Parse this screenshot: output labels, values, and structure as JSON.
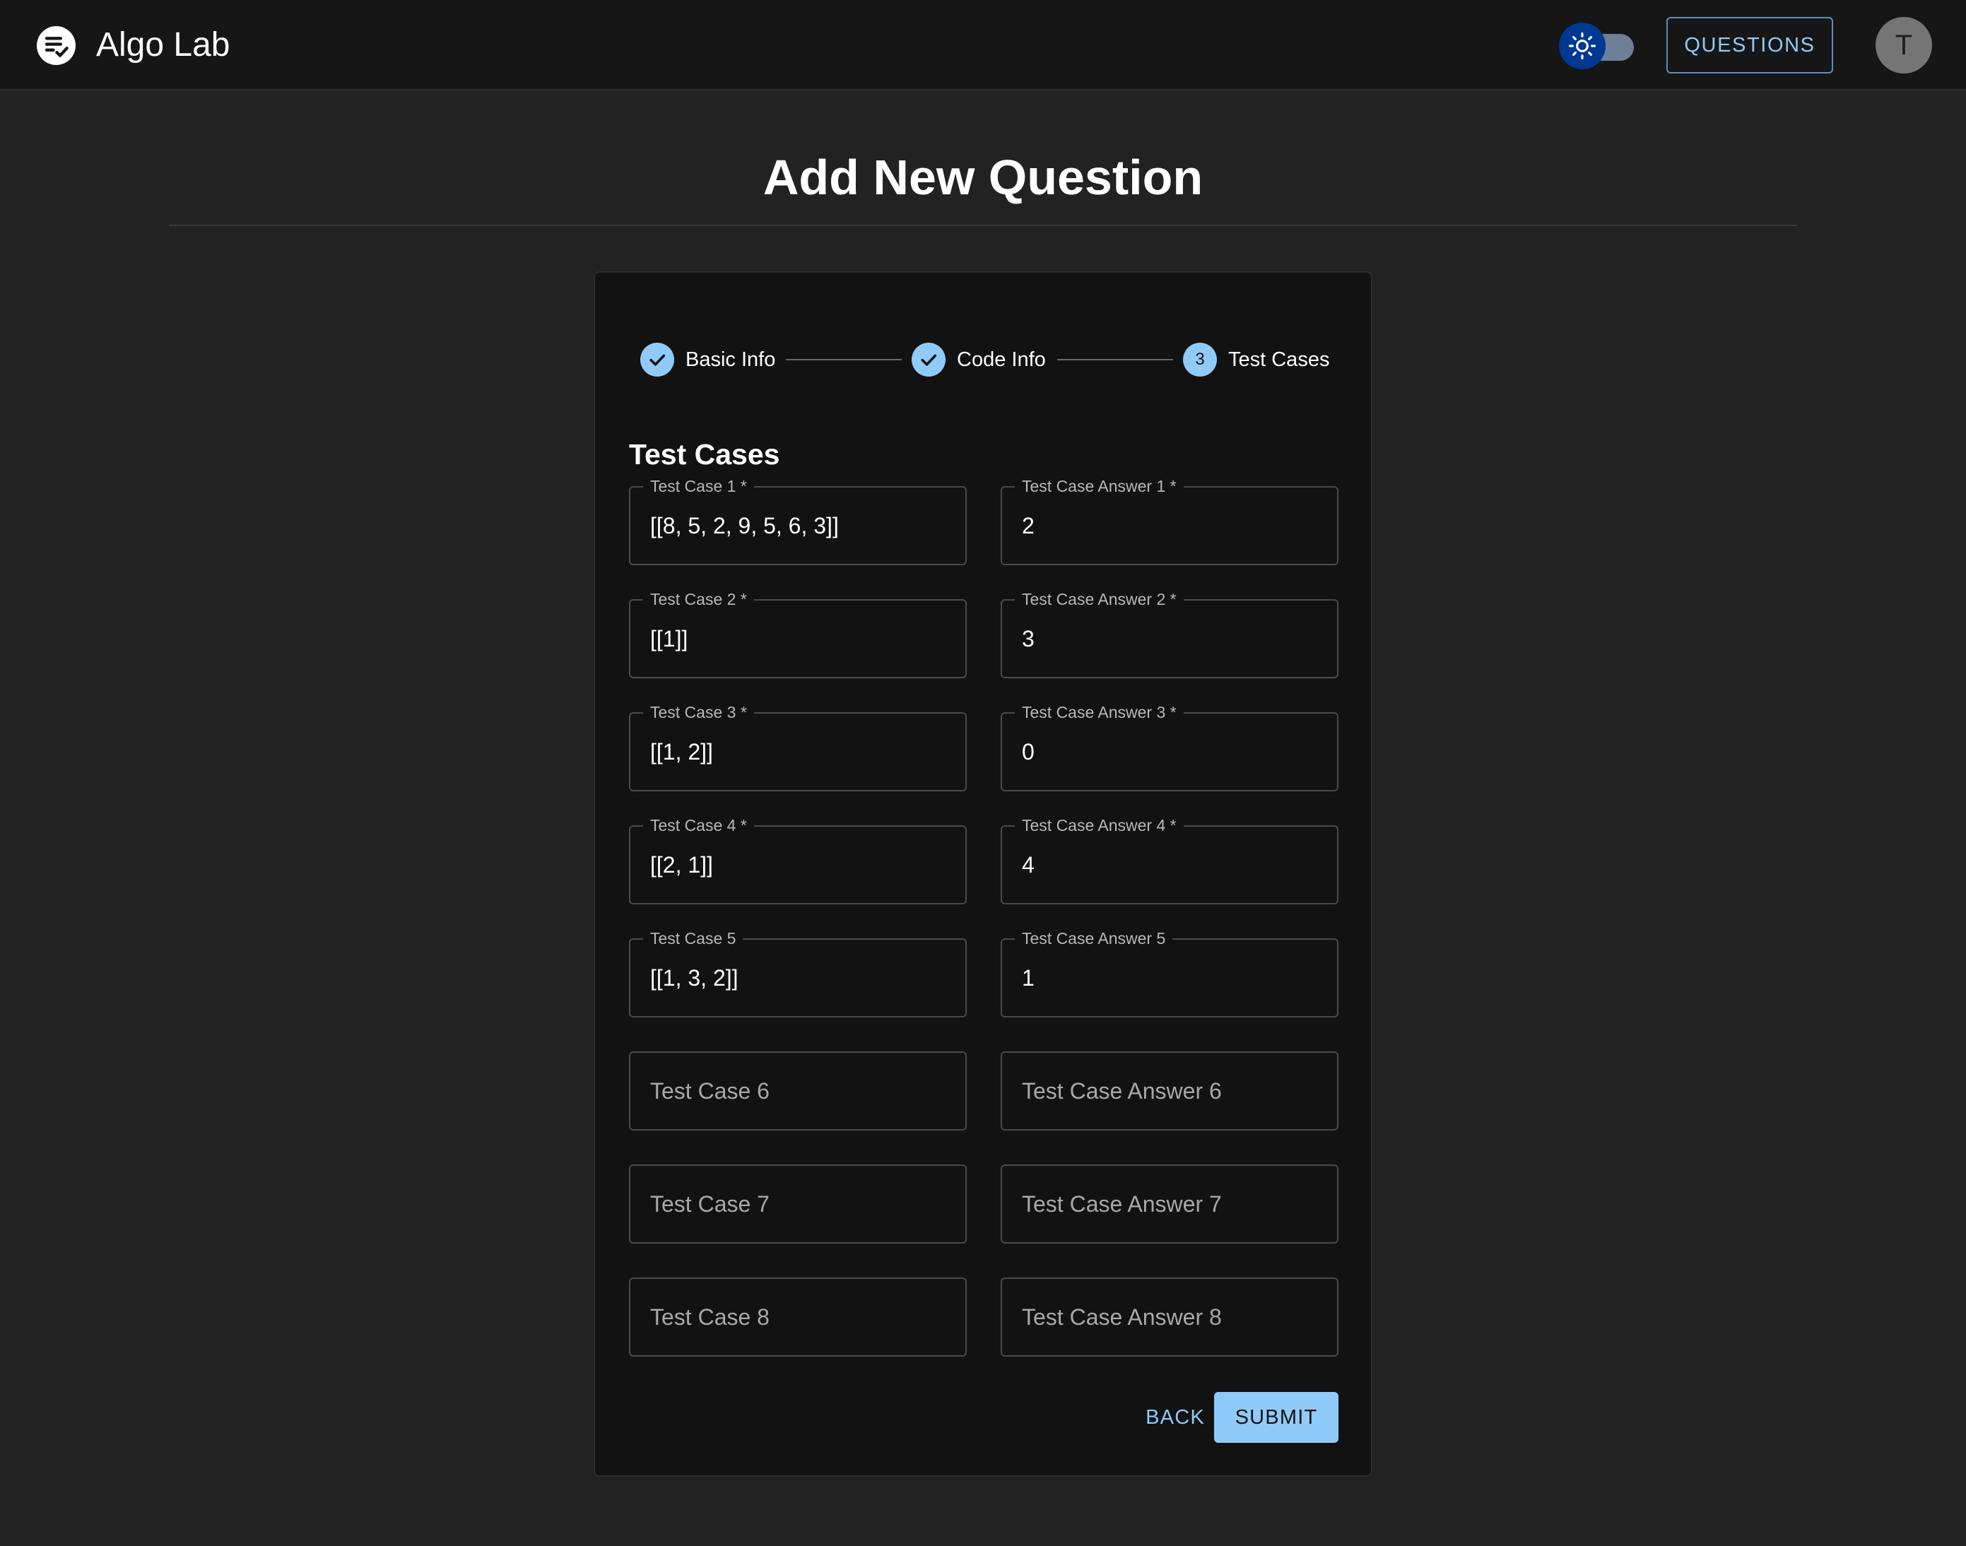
{
  "app": {
    "title": "Algo Lab",
    "logo_icon": "quiz-check-icon"
  },
  "header": {
    "theme_toggle_icon": "sun-icon",
    "theme_mode": "dark",
    "questions_label": "QUESTIONS",
    "avatar_initial": "T"
  },
  "page": {
    "title": "Add New Question"
  },
  "stepper": {
    "steps": [
      {
        "label": "Basic Info",
        "state": "completed",
        "icon": "check-icon"
      },
      {
        "label": "Code Info",
        "state": "completed",
        "icon": "check-icon"
      },
      {
        "label": "Test Cases",
        "state": "active",
        "number": "3"
      }
    ]
  },
  "form": {
    "section_title": "Test Cases",
    "rows": [
      {
        "case": {
          "label": "Test Case 1 *",
          "value": "[[8, 5, 2, 9, 5, 6, 3]]",
          "placeholder": ""
        },
        "answer": {
          "label": "Test Case Answer 1 *",
          "value": "2",
          "placeholder": ""
        }
      },
      {
        "case": {
          "label": "Test Case 2 *",
          "value": "[[1]]",
          "placeholder": ""
        },
        "answer": {
          "label": "Test Case Answer 2 *",
          "value": "3",
          "placeholder": ""
        }
      },
      {
        "case": {
          "label": "Test Case 3 *",
          "value": "[[1, 2]]",
          "placeholder": ""
        },
        "answer": {
          "label": "Test Case Answer 3 *",
          "value": "0",
          "placeholder": ""
        }
      },
      {
        "case": {
          "label": "Test Case 4 *",
          "value": "[[2, 1]]",
          "placeholder": ""
        },
        "answer": {
          "label": "Test Case Answer 4 *",
          "value": "4",
          "placeholder": ""
        }
      },
      {
        "case": {
          "label": "Test Case 5",
          "value": "[[1, 3, 2]]",
          "placeholder": ""
        },
        "answer": {
          "label": "Test Case Answer 5",
          "value": "1",
          "placeholder": ""
        }
      },
      {
        "case": {
          "label": "",
          "value": "",
          "placeholder": "Test Case 6"
        },
        "answer": {
          "label": "",
          "value": "",
          "placeholder": "Test Case Answer 6"
        }
      },
      {
        "case": {
          "label": "",
          "value": "",
          "placeholder": "Test Case 7"
        },
        "answer": {
          "label": "",
          "value": "",
          "placeholder": "Test Case Answer 7"
        }
      },
      {
        "case": {
          "label": "",
          "value": "",
          "placeholder": "Test Case 8"
        },
        "answer": {
          "label": "",
          "value": "",
          "placeholder": "Test Case Answer 8"
        }
      }
    ],
    "back_label": "BACK",
    "submit_label": "SUBMIT"
  },
  "colors": {
    "primary": "#90caf9",
    "background": "#222222",
    "surface": "#121212",
    "appbar": "#161616",
    "toggle_thumb": "#003892"
  }
}
